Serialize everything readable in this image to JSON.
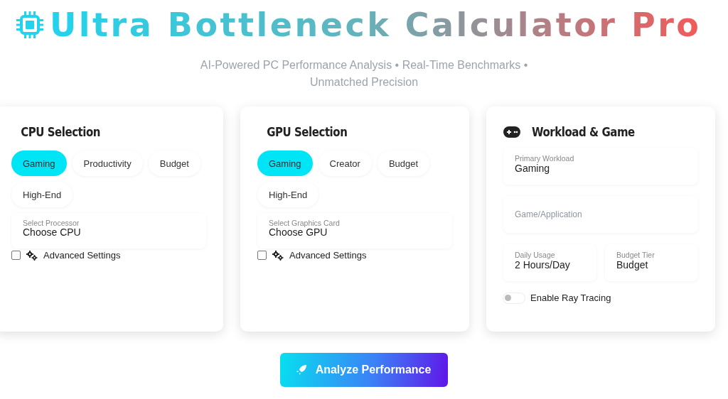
{
  "header": {
    "title_parts": [
      "Ultra Bottleneck",
      "Calculator Pro"
    ],
    "subtitle": "AI-Powered PC Performance Analysis • Real-Time Benchmarks • Unmatched Precision"
  },
  "cards": [
    {
      "kind": "selection",
      "title": "CPU Selection",
      "categories": [
        {
          "label": "Gaming",
          "selected": true
        },
        {
          "label": "Productivity",
          "selected": false
        },
        {
          "label": "Budget",
          "selected": false
        },
        {
          "label": "High-End",
          "selected": false
        }
      ],
      "select": {
        "label": "Select Processor",
        "value": "Choose CPU"
      },
      "advanced": {
        "label": "Advanced Settings",
        "checked": false
      }
    },
    {
      "kind": "selection",
      "title": "GPU Selection",
      "categories": [
        {
          "label": "Gaming",
          "selected": true
        },
        {
          "label": "Creator",
          "selected": false
        },
        {
          "label": "Budget",
          "selected": false
        },
        {
          "label": "High-End",
          "selected": false
        }
      ],
      "select": {
        "label": "Select Graphics Card",
        "value": "Choose GPU"
      },
      "advanced": {
        "label": "Advanced Settings",
        "checked": false
      }
    },
    {
      "kind": "workload",
      "title": "Workload & Game",
      "primary_workload": {
        "label": "Primary Workload",
        "value": "Gaming"
      },
      "game": {
        "placeholder": "Game/Application"
      },
      "daily_usage": {
        "label": "Daily Usage",
        "value": "2 Hours/Day"
      },
      "budget_tier": {
        "label": "Budget Tier",
        "value": "Budget"
      },
      "ray_tracing": {
        "label": "Enable Ray Tracing",
        "on": false
      }
    }
  ],
  "analyze_button": "Analyze Performance"
}
